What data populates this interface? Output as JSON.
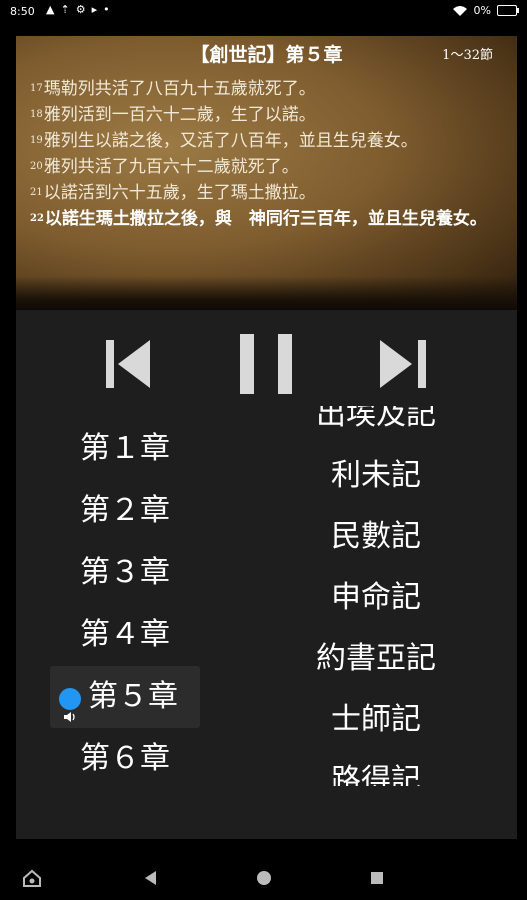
{
  "status": {
    "time": "8:50",
    "battery": "0%"
  },
  "scroll": {
    "title": "【創世記】第５章",
    "range": "1～32節",
    "verses": [
      {
        "num": "17",
        "text": "瑪勒列共活了八百九十五歲就死了。"
      },
      {
        "num": "18",
        "text": "雅列活到一百六十二歲，生了以諾。"
      },
      {
        "num": "19",
        "text": "雅列生以諾之後，又活了八百年，並且生兒養女。"
      },
      {
        "num": "20",
        "text": "雅列共活了九百六十二歲就死了。"
      },
      {
        "num": "21",
        "text": "以諾活到六十五歲，生了瑪土撒拉。"
      },
      {
        "num": "22",
        "text": "以諾生瑪土撒拉之後，與　神同行三百年，並且生兒養女。"
      }
    ]
  },
  "chapters": [
    "第１章",
    "第２章",
    "第３章",
    "第４章",
    "第５章",
    "第６章"
  ],
  "active_chapter_index": 4,
  "books": [
    "出埃及記",
    "利未記",
    "民數記",
    "申命記",
    "約書亞記",
    "士師記",
    "路得記"
  ],
  "colors": {
    "accent": "#2196f3",
    "panel": "#1e1e1e",
    "active_row": "#2c2c2c"
  }
}
